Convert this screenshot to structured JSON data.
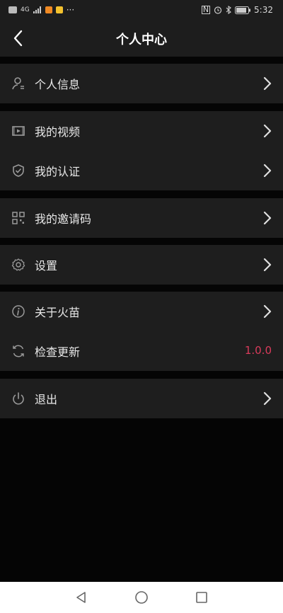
{
  "status_bar": {
    "left_indicators": "4G",
    "dots": "···",
    "right_indicators": "N",
    "time": "5:32"
  },
  "header": {
    "title": "个人中心",
    "back_icon": "chevron-left-icon"
  },
  "menu": {
    "groups": [
      {
        "items": [
          {
            "label": "个人信息",
            "icon": "user-icon",
            "action": "chevron-right-icon"
          }
        ]
      },
      {
        "items": [
          {
            "label": "我的视频",
            "icon": "video-icon",
            "action": "chevron-right-icon"
          },
          {
            "label": "我的认证",
            "icon": "shield-check-icon",
            "action": "chevron-right-icon"
          }
        ]
      },
      {
        "items": [
          {
            "label": "我的邀请码",
            "icon": "qr-code-icon",
            "action": "chevron-right-icon"
          }
        ]
      },
      {
        "items": [
          {
            "label": "设置",
            "icon": "gear-icon",
            "action": "chevron-right-icon"
          }
        ]
      },
      {
        "items": [
          {
            "label": "关于火苗",
            "icon": "info-icon",
            "action": "chevron-right-icon"
          },
          {
            "label": "检查更新",
            "icon": "refresh-icon",
            "value": "1.0.0"
          }
        ]
      },
      {
        "items": [
          {
            "label": "退出",
            "icon": "power-icon",
            "action": "chevron-right-icon"
          }
        ]
      }
    ]
  },
  "colors": {
    "background": "#050505",
    "panel": "#1e1e1e",
    "text": "#e8e8e8",
    "version_accent": "#d93b5b"
  },
  "nav_bar": {
    "back_icon": "triangle-back-icon",
    "home_icon": "circle-home-icon",
    "recents_icon": "square-recents-icon"
  }
}
